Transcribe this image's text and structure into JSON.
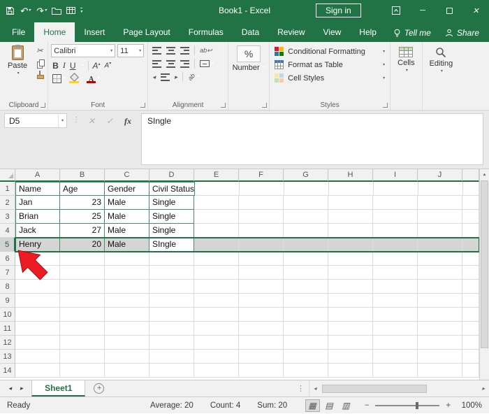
{
  "colors": {
    "accent": "#217346",
    "selection_fill": "#d5d5d5",
    "data_border": "#3f9468",
    "arrow_red": "#ed1c24"
  },
  "icons": {
    "undo": "↶",
    "redo": "↷",
    "chevron_down": "▾",
    "scissors": "✂",
    "cancel": "✕",
    "check": "✓",
    "minimize": "─",
    "close": "✕",
    "up_arrow": "▲",
    "left_arrow": "◂",
    "right_arrow": "▸",
    "dots": "⋮",
    "drag_dots": "⋮",
    "normal_view": "▦",
    "page_layout_view": "▤",
    "page_break_view": "▥",
    "minus": "−",
    "plus": "+",
    "wrap_return": "↩",
    "sup_up": "▴",
    "sup_down": "▾",
    "add": "+"
  },
  "title_bar": {
    "title": "Book1 -  Excel",
    "sign_in_label": "Sign in"
  },
  "ribbon_tabs": {
    "items": [
      "File",
      "Home",
      "Insert",
      "Page Layout",
      "Formulas",
      "Data",
      "Review",
      "View",
      "Help"
    ],
    "active": "Home",
    "tell_me_label": "Tell me",
    "share_label": "Share"
  },
  "ribbon": {
    "group_labels": {
      "clipboard": "Clipboard",
      "font": "Font",
      "alignment": "Alignment",
      "styles": "Styles"
    },
    "clipboard": {
      "paste_label": "Paste"
    },
    "font": {
      "family": "Calibri",
      "size": "11",
      "bold": "B",
      "italic": "I",
      "underline": "U",
      "color_letter": "A",
      "grow_letter": "A",
      "shrink_letter": "A"
    },
    "alignment": {
      "wrap_text": "ab",
      "orientation_text": "ab"
    },
    "number": {
      "percent": "%",
      "label": "Number"
    },
    "styles": {
      "items": [
        "Conditional Formatting",
        "Format as Table",
        "Cell Styles"
      ]
    },
    "cells": {
      "label": "Cells"
    },
    "editing": {
      "label": "Editing"
    }
  },
  "formula_bar": {
    "name_box": "D5",
    "fx": "fx",
    "content": "SIngle"
  },
  "grid": {
    "columns": [
      "A",
      "B",
      "C",
      "D",
      "E",
      "F",
      "G",
      "H",
      "I",
      "J"
    ],
    "row_count": 14,
    "table": {
      "1": [
        "Name",
        "Age",
        "Gender",
        "Civil Status"
      ],
      "2": [
        "Jan",
        "23",
        "Male",
        "Single"
      ],
      "3": [
        "Brian",
        "25",
        "Male",
        "Single"
      ],
      "4": [
        "Jack",
        "27",
        "Male",
        "Single"
      ],
      "5": [
        "Henry",
        "20",
        "Male",
        "SIngle"
      ]
    },
    "data_range": {
      "rows": 5,
      "cols": 4
    },
    "selected_row": 5,
    "active_cell": "D5"
  },
  "sheet_bar": {
    "tabs": [
      "Sheet1"
    ],
    "active": "Sheet1"
  },
  "status_bar": {
    "mode": "Ready",
    "average": "Average: 20",
    "count": "Count: 4",
    "sum": "Sum: 20",
    "zoom": "100%"
  }
}
